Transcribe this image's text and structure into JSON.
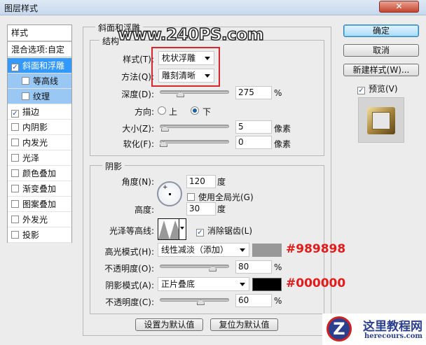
{
  "window": {
    "title": "图层样式",
    "close": "✕"
  },
  "left": {
    "header": "样式",
    "blend": "混合选项:自定",
    "items": [
      {
        "label": "斜面和浮雕",
        "checked": true
      },
      {
        "label": "等高线",
        "checked": false
      },
      {
        "label": "纹理",
        "checked": false
      },
      {
        "label": "描边",
        "checked": true
      },
      {
        "label": "内阴影",
        "checked": false
      },
      {
        "label": "内发光",
        "checked": false
      },
      {
        "label": "光泽",
        "checked": false
      },
      {
        "label": "颜色叠加",
        "checked": false
      },
      {
        "label": "渐变叠加",
        "checked": false
      },
      {
        "label": "图案叠加",
        "checked": false
      },
      {
        "label": "外发光",
        "checked": false
      },
      {
        "label": "投影",
        "checked": false
      }
    ]
  },
  "bevel": {
    "title": "斜面和浮雕",
    "structure": "结构",
    "style_label": "样式(T):",
    "style_value": "枕状浮雕",
    "technique_label": "方法(Q):",
    "technique_value": "雕刻清晰",
    "depth_label": "深度(D):",
    "depth_value": "275",
    "depth_unit": "%",
    "depth_frac": 0.275,
    "direction_label": "方向:",
    "dir_up": "上",
    "dir_down": "下",
    "size_label": "大小(Z):",
    "size_value": "5",
    "size_unit": "像素",
    "size_frac": 0.02,
    "soften_label": "软化(F):",
    "soften_value": "0",
    "soften_unit": "像素",
    "soften_frac": 0
  },
  "shading": {
    "title": "阴影",
    "angle_label": "角度(N):",
    "angle_value": "120",
    "angle_unit": "度",
    "global_light": "使用全局光(G)",
    "altitude_label": "高度:",
    "altitude_value": "30",
    "altitude_unit": "度",
    "gloss_label": "光泽等高线:",
    "antialias": "消除锯齿(L)",
    "highlight_label": "高光模式(H):",
    "highlight_mode": "线性减淡（添加）",
    "highlight_color": "#989898",
    "highlight_hex": "#989898",
    "hl_opacity_label": "不透明度(O):",
    "hl_opacity": "80",
    "hl_unit": "%",
    "hl_frac": 0.8,
    "shadow_label": "阴影模式(A):",
    "shadow_mode": "正片叠底",
    "shadow_color": "#000000",
    "shadow_hex": "#000000",
    "sh_opacity_label": "不透明度(C):",
    "sh_opacity": "60",
    "sh_unit": "%",
    "sh_frac": 0.6
  },
  "buttons": {
    "make_default": "设置为默认值",
    "reset_default": "复位为默认值",
    "ok": "确定",
    "cancel": "取消",
    "new_style": "新建样式(W)...",
    "preview": "预览(V)"
  },
  "watermarks": {
    "top": "www.240PS.com",
    "logo_cn": "这里教程网",
    "logo_en": "herecours.com"
  }
}
